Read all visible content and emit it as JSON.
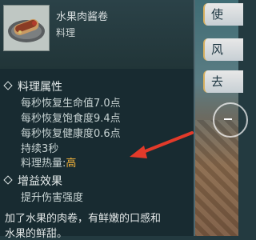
{
  "side_buttons": [
    "使",
    "风",
    "去"
  ],
  "item": {
    "name": "水果肉酱卷",
    "type": "料理"
  },
  "sections": {
    "attributes_title": "料理属性",
    "attributes": [
      "每秒恢复生命值7.0点",
      "每秒恢复饱食度9.4点",
      "每秒恢复健康度0.6点",
      "持续3秒"
    ],
    "heat_label": "料理热量:",
    "heat_value": "高",
    "buff_title": "增益效果",
    "buff": "提升伤害强度"
  },
  "description": [
    "加了水果的肉卷，有鲜嫩的口感和",
    "水果的鲜甜。"
  ],
  "colors": {
    "highlight": "#f0b23a",
    "arrow": "#e23a2a"
  }
}
